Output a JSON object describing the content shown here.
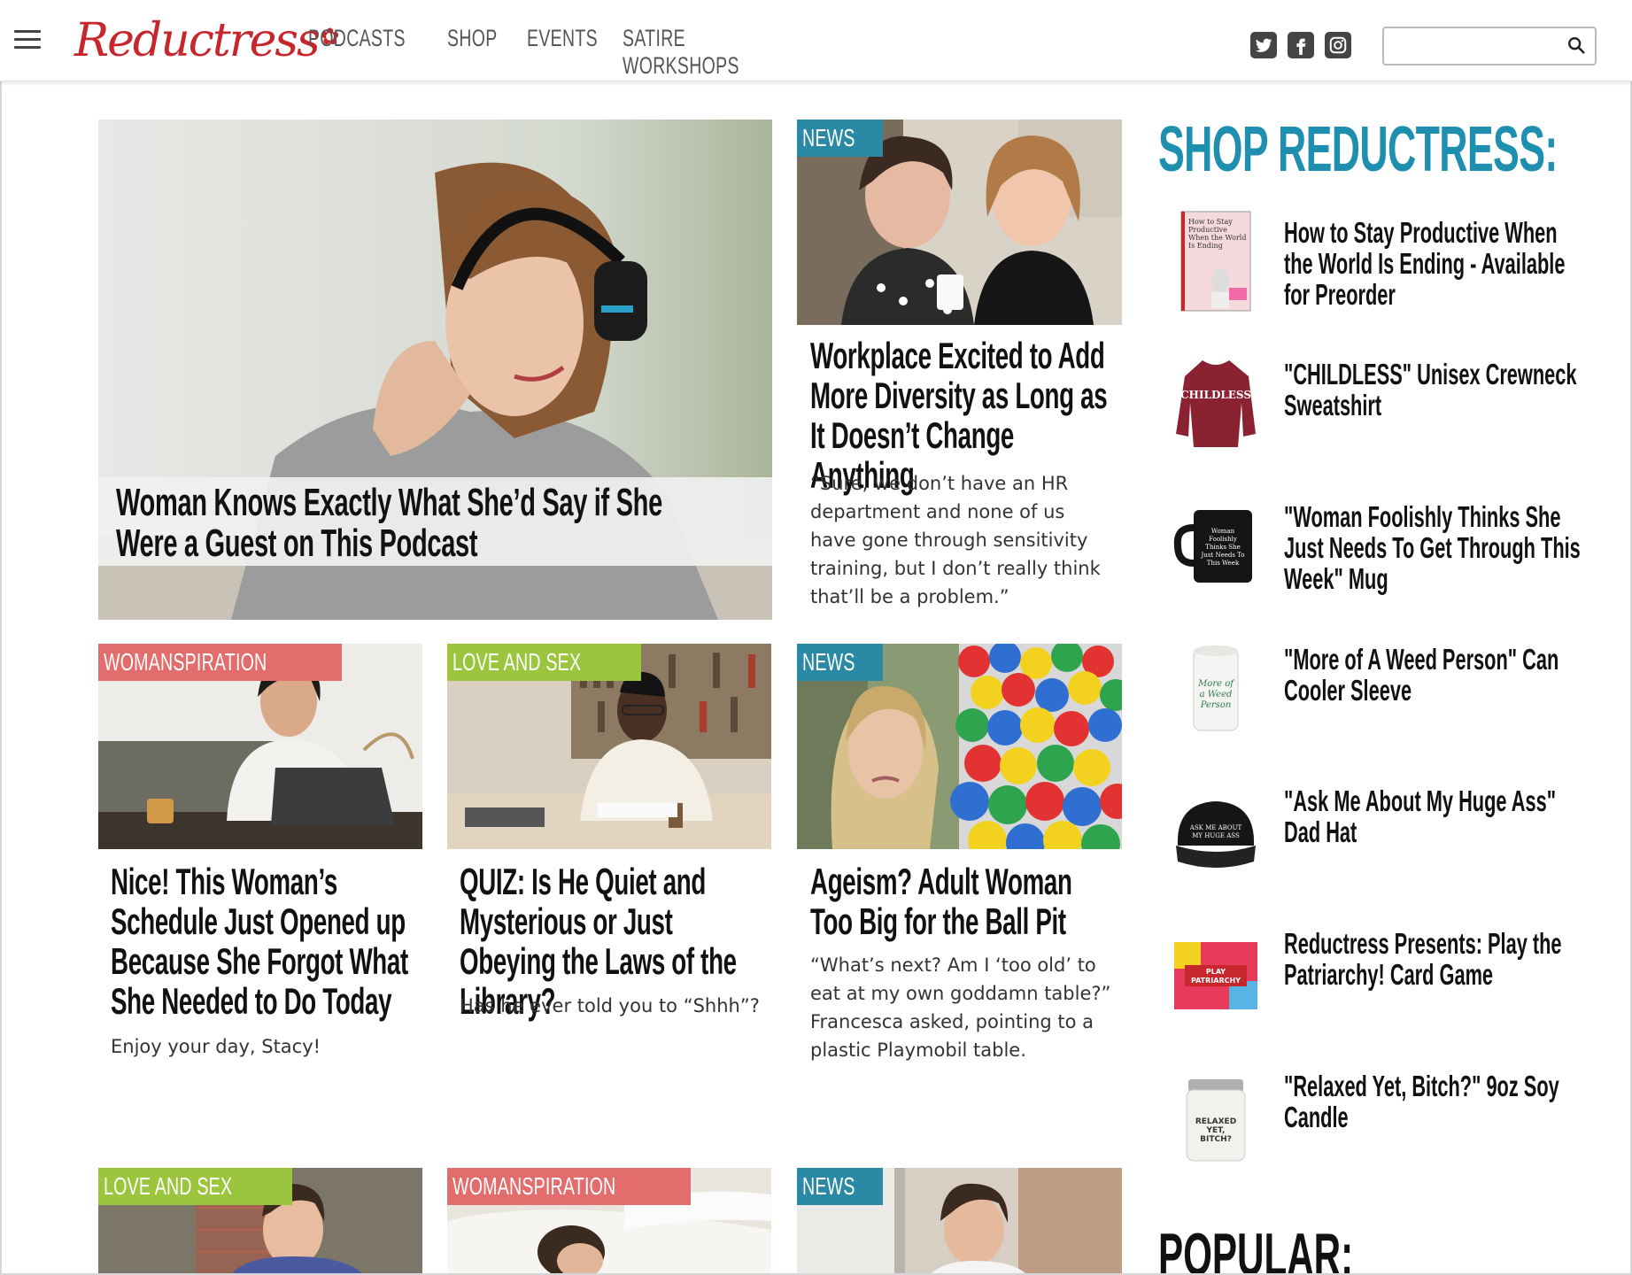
{
  "header": {
    "logo": "Reductress",
    "nav": [
      "PODCASTS",
      "SHOP",
      "EVENTS",
      "SATIRE WORKSHOPS"
    ],
    "social": [
      "twitter-icon",
      "facebook-icon",
      "instagram-icon"
    ],
    "search_placeholder": ""
  },
  "colors": {
    "brand_red": "#c8262d",
    "news": "#2a8aa6",
    "womanspiration": "#e36c6c",
    "love_and_sex": "#9bc53d",
    "shop_title": "#1f8fb0"
  },
  "featured": {
    "headline": "Woman Knows Exactly What She’d Say if She Were a Guest on This Podcast"
  },
  "articles": [
    {
      "tag": "NEWS",
      "headline": "Workplace Excited to Add More Diversity as Long as It Doesn’t Change Anything",
      "dek": "“Sure, we don’t have an HR department and none of us have gone through sensitivity training, but I don’t really think that’ll be a problem.”"
    },
    {
      "tag": "WOMANSPIRATION",
      "headline": "Nice! This Woman’s Schedule Just Opened up Because She Forgot What She Needed to Do Today",
      "dek": "Enjoy your day, Stacy!"
    },
    {
      "tag": "LOVE AND SEX",
      "headline": "QUIZ: Is He Quiet and Mysterious or Just Obeying the Laws of the Library?",
      "dek": "Has he ever told you to “Shhh”?"
    },
    {
      "tag": "NEWS",
      "headline": "Ageism? Adult Woman Too Big for the Ball Pit",
      "dek": "“What’s next? Am I ‘too old’ to eat at my own goddamn table?” Francesca asked, pointing to a plastic Playmobil table."
    },
    {
      "tag": "LOVE AND SEX"
    },
    {
      "tag": "WOMANSPIRATION"
    },
    {
      "tag": "NEWS"
    }
  ],
  "shop": {
    "title": "SHOP REDUCTRESS:",
    "items": [
      {
        "label": "How to Stay Productive When the World Is Ending - Available for Preorder",
        "thumb_text": "How to Stay Productive When the World Is Ending"
      },
      {
        "label": "\"CHILDLESS\" Unisex Crewneck Sweatshirt",
        "thumb_text": "CHILDLESS"
      },
      {
        "label": "\"Woman Foolishly Thinks She Just Needs To Get Through This Week\" Mug",
        "thumb_text": "Woman Foolishly Thinks She Just Needs To Get Through This Week"
      },
      {
        "label": "\"More of A Weed Person\" Can Cooler Sleeve",
        "thumb_text": "More of a Weed Person"
      },
      {
        "label": "\"Ask Me About My Huge Ass\" Dad Hat",
        "thumb_text": "ASK ME ABOUT MY HUGE ASS"
      },
      {
        "label": "Reductress Presents: Play the Patriarchy! Card Game",
        "thumb_text": "PLAY PATRIARCHY"
      },
      {
        "label": "\"Relaxed Yet, Bitch?\" 9oz Soy Candle",
        "thumb_text": "RELAXED YET, BITCH?"
      }
    ]
  },
  "popular": {
    "title": "POPULAR:"
  }
}
